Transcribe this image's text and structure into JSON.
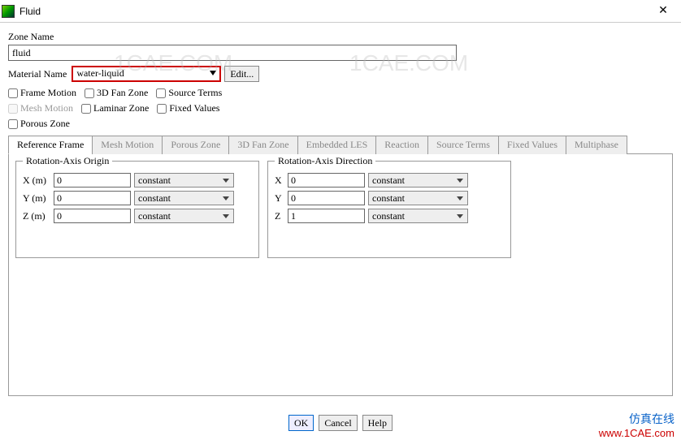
{
  "window": {
    "title": "Fluid"
  },
  "zone": {
    "label": "Zone Name",
    "value": "fluid"
  },
  "material": {
    "label": "Material Name",
    "value": "water-liquid",
    "edit_label": "Edit..."
  },
  "checks": {
    "frame_motion": "Frame Motion",
    "fan_zone": "3D Fan Zone",
    "source_terms": "Source Terms",
    "mesh_motion": "Mesh Motion",
    "laminar_zone": "Laminar Zone",
    "fixed_values": "Fixed Values",
    "porous_zone": "Porous Zone"
  },
  "tabs": [
    "Reference Frame",
    "Mesh Motion",
    "Porous Zone",
    "3D Fan Zone",
    "Embedded LES",
    "Reaction",
    "Source Terms",
    "Fixed Values",
    "Multiphase"
  ],
  "origin": {
    "title": "Rotation-Axis Origin",
    "rows": [
      {
        "label": "X (m)",
        "value": "0",
        "mode": "constant"
      },
      {
        "label": "Y (m)",
        "value": "0",
        "mode": "constant"
      },
      {
        "label": "Z (m)",
        "value": "0",
        "mode": "constant"
      }
    ]
  },
  "direction": {
    "title": "Rotation-Axis Direction",
    "rows": [
      {
        "label": "X",
        "value": "0",
        "mode": "constant"
      },
      {
        "label": "Y",
        "value": "0",
        "mode": "constant"
      },
      {
        "label": "Z",
        "value": "1",
        "mode": "constant"
      }
    ]
  },
  "buttons": {
    "ok": "OK",
    "cancel": "Cancel",
    "help": "Help"
  },
  "watermark": {
    "line1": "仿真在线",
    "line2": "www.1CAE.com",
    "faint": "1CAE.COM"
  }
}
